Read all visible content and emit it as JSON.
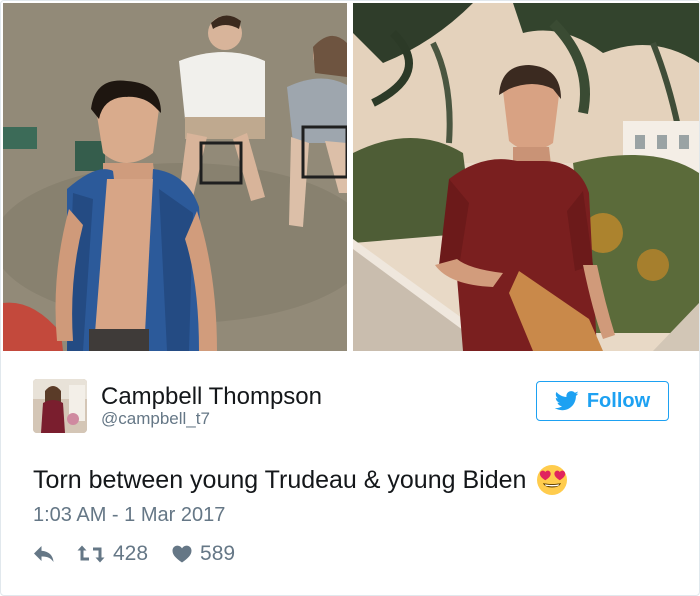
{
  "tweet": {
    "user": {
      "name": "Campbell Thompson",
      "handle": "@campbell_t7"
    },
    "follow_label": "Follow",
    "text": "Torn between young Trudeau & young Biden",
    "emoji": "heart-eyes-emoji",
    "timestamp": "1:03 AM - 1 Mar 2017",
    "retweet_count": "428",
    "like_count": "589"
  },
  "colors": {
    "brand_blue": "#1da1f2",
    "secondary_text": "#657786",
    "primary_text": "#14171a",
    "border": "#e1e8ed"
  },
  "icons": {
    "follow": "twitter-bird-icon",
    "reply": "reply-icon",
    "retweet": "retweet-icon",
    "like": "heart-icon"
  }
}
